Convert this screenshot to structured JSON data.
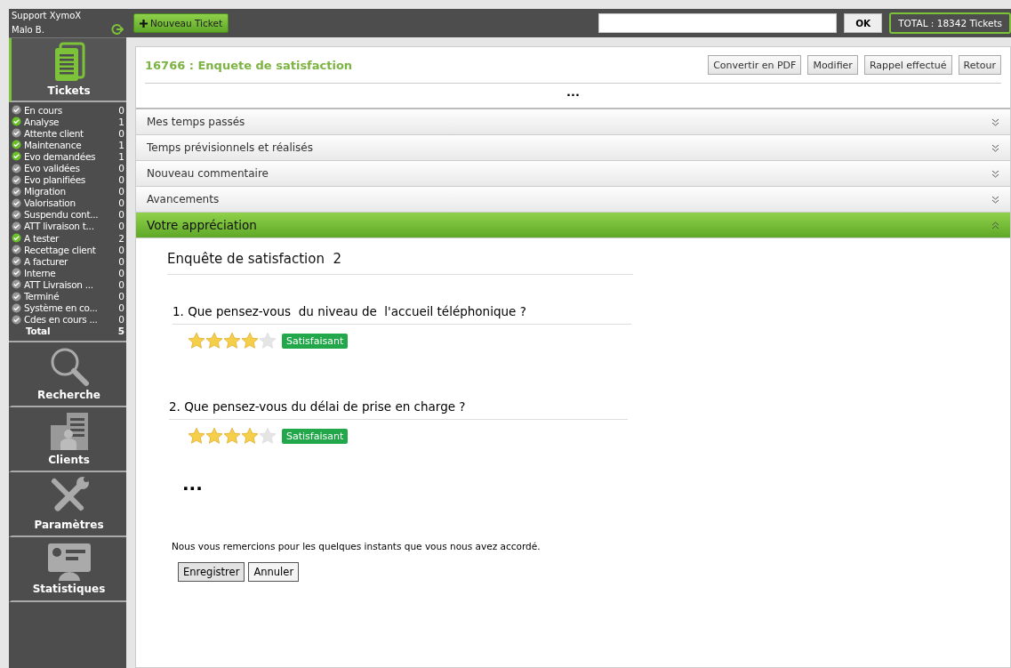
{
  "sidebar": {
    "app_name": "Support XymoX",
    "user": "Malo B.",
    "nav": [
      {
        "label": "Tickets",
        "kind": "tickets",
        "selected": true
      },
      {
        "label": "Recherche",
        "kind": "search",
        "selected": false
      },
      {
        "label": "Clients",
        "kind": "clients",
        "selected": false
      },
      {
        "label": "Paramètres",
        "kind": "settings",
        "selected": false
      },
      {
        "label": "Statistiques",
        "kind": "stats",
        "selected": false
      }
    ],
    "statuses": [
      {
        "label": "En cours",
        "count": "0",
        "checked": false
      },
      {
        "label": "Analyse",
        "count": "1",
        "checked": true
      },
      {
        "label": "Attente client",
        "count": "0",
        "checked": false
      },
      {
        "label": "Maintenance",
        "count": "1",
        "checked": true
      },
      {
        "label": "Evo demandées",
        "count": "1",
        "checked": true
      },
      {
        "label": "Evo validées",
        "count": "0",
        "checked": false
      },
      {
        "label": "Evo planifiées",
        "count": "0",
        "checked": false
      },
      {
        "label": "Migration",
        "count": "0",
        "checked": false
      },
      {
        "label": "Valorisation",
        "count": "0",
        "checked": false
      },
      {
        "label": "Suspendu cont...",
        "count": "0",
        "checked": false
      },
      {
        "label": "ATT livraison t...",
        "count": "0",
        "checked": false
      },
      {
        "label": "A tester",
        "count": "2",
        "checked": true
      },
      {
        "label": "Recettage client",
        "count": "0",
        "checked": false
      },
      {
        "label": "A facturer",
        "count": "0",
        "checked": false
      },
      {
        "label": "Interne",
        "count": "0",
        "checked": false
      },
      {
        "label": "ATT Livraison ...",
        "count": "0",
        "checked": false
      },
      {
        "label": "Terminé",
        "count": "0",
        "checked": false
      },
      {
        "label": "Système en co...",
        "count": "0",
        "checked": false
      },
      {
        "label": "Cdes en cours ...",
        "count": "0",
        "checked": false
      }
    ],
    "total": {
      "label": "Total",
      "count": "5"
    }
  },
  "toolbar": {
    "new_button": "Nouveau Ticket",
    "search_button": "OK",
    "total": "TOTAL : 18342 Tickets"
  },
  "ticket": {
    "title": "16766 : Enquete de satisfaction",
    "actions": [
      "Convertir en PDF",
      "Modifier",
      "Rappel effectué",
      "Retour"
    ],
    "ellipsis": "...",
    "sections": [
      {
        "label": "Mes temps passés",
        "expanded": false
      },
      {
        "label": "Temps prévisionnels et réalisés",
        "expanded": false
      },
      {
        "label": "Nouveau commentaire",
        "expanded": false
      },
      {
        "label": "Avancements",
        "expanded": false
      },
      {
        "label": "Votre appréciation",
        "expanded": true
      }
    ]
  },
  "survey": {
    "title": "Enquête de satisfaction",
    "count": "2",
    "questions": [
      {
        "text": "1. Que pensez-vous  du niveau de  l'accueil téléphonique ?",
        "stars": 4,
        "rating": "Satisfaisant"
      },
      {
        "text": "2. Que pensez-vous du délai de prise en charge ?",
        "stars": 4,
        "rating": "Satisfaisant"
      }
    ],
    "more": "...",
    "thanks": "Nous vous remercions pour les quelques instants que vous nous avez accordé.",
    "buttons": [
      "Enregistrer",
      "Annuler"
    ]
  }
}
